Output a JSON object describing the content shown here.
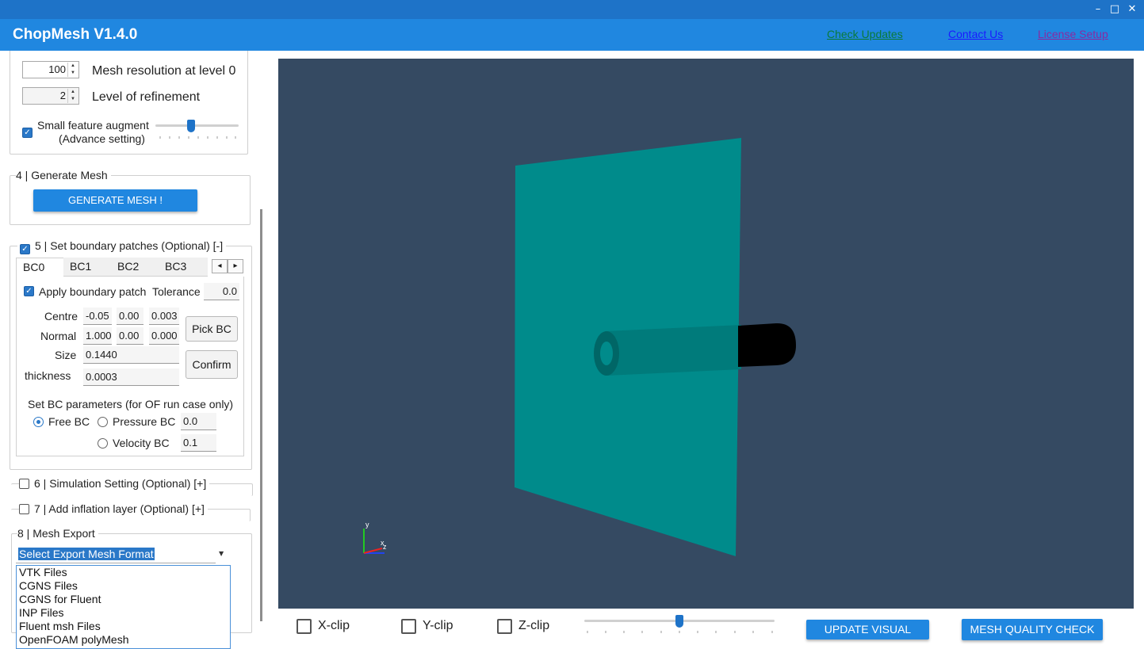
{
  "window": {
    "title": "ChopMesh V1.4.0",
    "controls": [
      "–",
      "□",
      "✕"
    ]
  },
  "header": {
    "links": {
      "check_updates": "Check Updates",
      "contact_us": "Contact Us ",
      "license_setup": "License Setup"
    },
    "colors": {
      "check_updates": "#0a7a3a",
      "contact_us": "#1a1aff",
      "license_setup": "#8a2aa0"
    }
  },
  "mesh_settings": {
    "resolution_value": "100",
    "resolution_label": "Mesh resolution at level 0",
    "refinement_value": "2",
    "refinement_label": "Level of refinement",
    "small_feature_label": "Small feature augment",
    "advance_label": "(Advance setting)"
  },
  "generate": {
    "group_label": "4  | Generate Mesh",
    "button": "GENERATE MESH !"
  },
  "boundary": {
    "group_label": "5 | Set boundary patches (Optional) [-]",
    "tabs": [
      "BC0",
      "BC1",
      "BC2",
      "BC3"
    ],
    "tab_prev": "◂",
    "tab_next": "▸",
    "apply_label": "Apply boundary patch",
    "tolerance_label": "Tolerance",
    "tolerance_value": "0.0",
    "centre_label": "Centre",
    "centre_values": [
      "-0.05",
      "0.00",
      "0.003"
    ],
    "normal_label": "Normal",
    "normal_values": [
      "1.000",
      "0.00",
      "0.000"
    ],
    "size_label": "Size",
    "size_value": "0.1440",
    "thickness_label": "thickness",
    "thickness_value": "0.0003",
    "pick_button": "Pick BC",
    "confirm_button": "Confirm",
    "params_label": "Set BC parameters (for OF run case only)",
    "free_bc": "Free BC",
    "pressure_bc": "Pressure BC",
    "pressure_value": "0.0",
    "velocity_bc": "Velocity BC",
    "velocity_value": "0.1"
  },
  "simulation": {
    "group_label": "6 | Simulation Setting (Optional) [+]"
  },
  "inflation": {
    "group_label": "7 | Add inflation layer (Optional) [+]"
  },
  "export": {
    "group_label": "8 | Mesh Export",
    "selected": "Select Export Mesh Format",
    "options": [
      "VTK Files",
      "CGNS Files",
      "CGNS for Fluent",
      "INP Files",
      "Fluent msh Files",
      "OpenFOAM polyMesh"
    ]
  },
  "viewport": {
    "background": "#354a62",
    "plate_color": "#008b8b",
    "pipe_color": "#006e6e",
    "axes": {
      "y": "y",
      "z": "z",
      "x": "x"
    }
  },
  "bottom": {
    "x_clip": "X-clip",
    "y_clip": "Y-clip",
    "z_clip": "Z-clip",
    "clip_slider_level": 0.5,
    "update_visual": "UPDATE VISUAL",
    "mesh_quality": "MESH QUALITY CHECK"
  }
}
